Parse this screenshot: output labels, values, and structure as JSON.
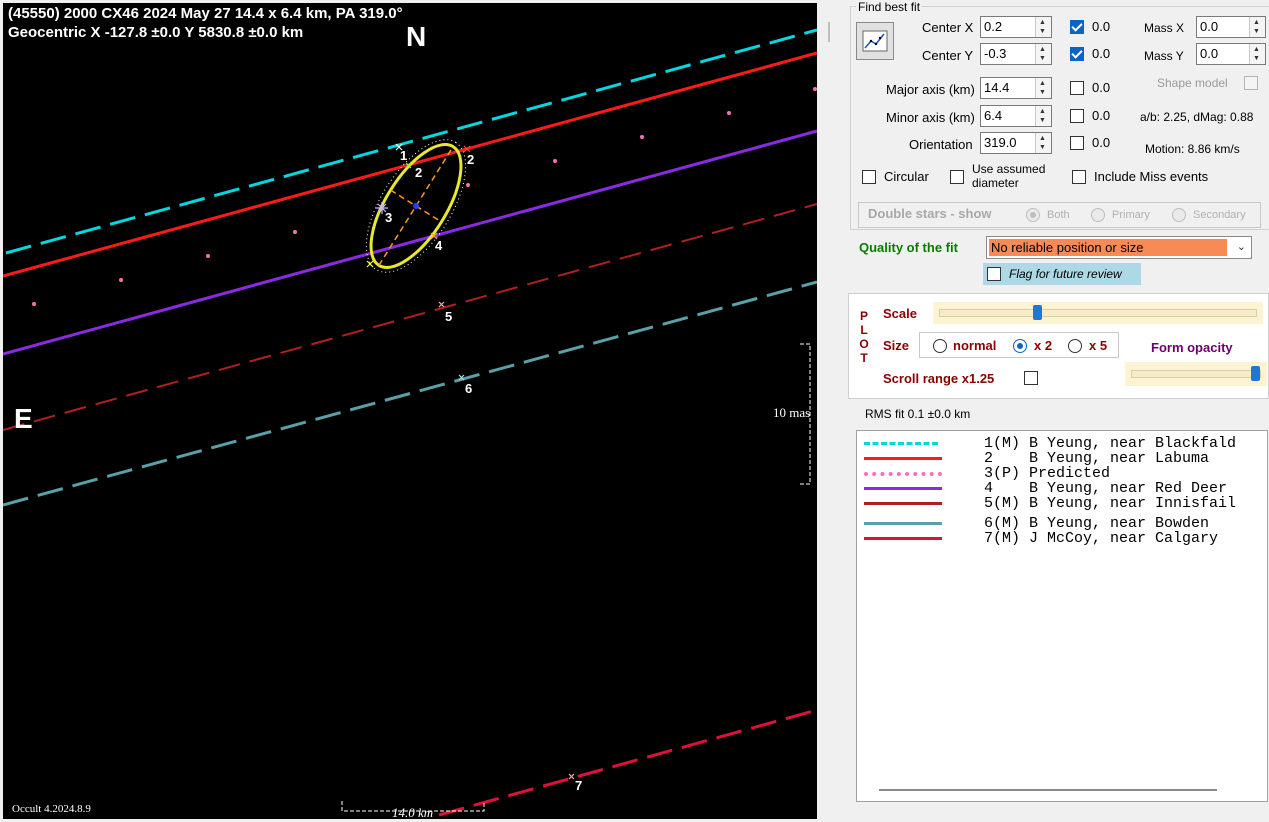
{
  "plot": {
    "title_line1": "(45550) 2000 CX46  2024 May 27  14.4 x 6.4 km, PA 319.0°",
    "title_line2": "Geocentric  X  -127.8 ±0.0  Y 5830.8 ±0.0 km",
    "north_label": "N",
    "east_label": "E",
    "scale_mas_label": "10 mas",
    "scale_km_label": "14.0 km",
    "version_label": "Occult 4.2024.8.9",
    "chord_numbers": [
      "1",
      "2",
      "3",
      "4",
      "5",
      "6",
      "7"
    ],
    "ellipse_point_labels": [
      "1",
      "2",
      "2",
      "3",
      "4"
    ],
    "colors": {
      "chord1": "#00d8e0",
      "chord2": "#ff1a1a",
      "predicted": "#ff6fb5",
      "chord4": "#8a2be2",
      "chord5": "#b02020",
      "chord6": "#5aa0a8",
      "chord7": "#e0103a",
      "ellipse": "#e8e830"
    }
  },
  "panel": {
    "find_best_fit_label": "Find best fit",
    "fit_button_icon": "line-chart-icon",
    "fields": {
      "center_x": {
        "label": "Center X",
        "value": "0.2",
        "fit_checked": true,
        "fit_value": "0.0"
      },
      "center_y": {
        "label": "Center Y",
        "value": "-0.3",
        "fit_checked": true,
        "fit_value": "0.0"
      },
      "major_axis": {
        "label": "Major axis (km)",
        "value": "14.4",
        "fit_checked": false,
        "fit_value": "0.0"
      },
      "minor_axis": {
        "label": "Minor axis (km)",
        "value": "6.4",
        "fit_checked": false,
        "fit_value": "0.0"
      },
      "orientation": {
        "label": "Orientation",
        "value": "319.0",
        "fit_checked": false,
        "fit_value": "0.0"
      }
    },
    "mass_x": {
      "label": "Mass X",
      "value": "0.0"
    },
    "mass_y": {
      "label": "Mass Y",
      "value": "0.0"
    },
    "shape_model_label": "Shape model",
    "ab_dmag_text": "a/b: 2.25, dMag: 0.88",
    "motion_text": "Motion: 8.86 km/s",
    "circular_label": "Circular",
    "use_assumed_diameter_label": "Use assumed diameter",
    "include_miss_label": "Include Miss events",
    "double_stars_label": "Double stars - show",
    "double_star_options": [
      "Both",
      "Primary",
      "Secondary"
    ],
    "quality_label": "Quality of the fit",
    "quality_value": "No reliable position or size",
    "flag_review_label": "Flag for future review",
    "plot_section": {
      "vertical_label": [
        "P",
        "L",
        "O",
        "T"
      ],
      "scale_label": "Scale",
      "scale_level": 0.31,
      "size_label": "Size",
      "size_options": [
        "normal",
        "x 2",
        "x 5"
      ],
      "size_selected": "x 2",
      "form_opacity_label": "Form opacity",
      "opacity_level": 0.97,
      "scroll_range_label": "Scroll range x1.25"
    },
    "rms_fit_text": "RMS fit 0.1 ±0.0 km",
    "legend": [
      {
        "text": " 1(M) B Yeung, near Blackfald",
        "color": "#00d8e0",
        "style": "dense"
      },
      {
        "text": " 2    B Yeung, near Labuma",
        "color": "#ff1a1a",
        "style": "solid"
      },
      {
        "text": " 3(P) Predicted",
        "color": "#ff6fb5",
        "style": "dots"
      },
      {
        "text": " 4    B Yeung, near Red Deer",
        "color": "#8a2be2",
        "style": "solid"
      },
      {
        "text": " 5(M) B Yeung, near Innisfail",
        "color": "#b02020",
        "style": "solid"
      },
      {
        "text": " 6(M) B Yeung, near Bowden",
        "color": "#5aa0a8",
        "style": "solid"
      },
      {
        "text": " 7(M) J McCoy, near Calgary",
        "color": "#e0103a",
        "style": "solid"
      }
    ]
  }
}
